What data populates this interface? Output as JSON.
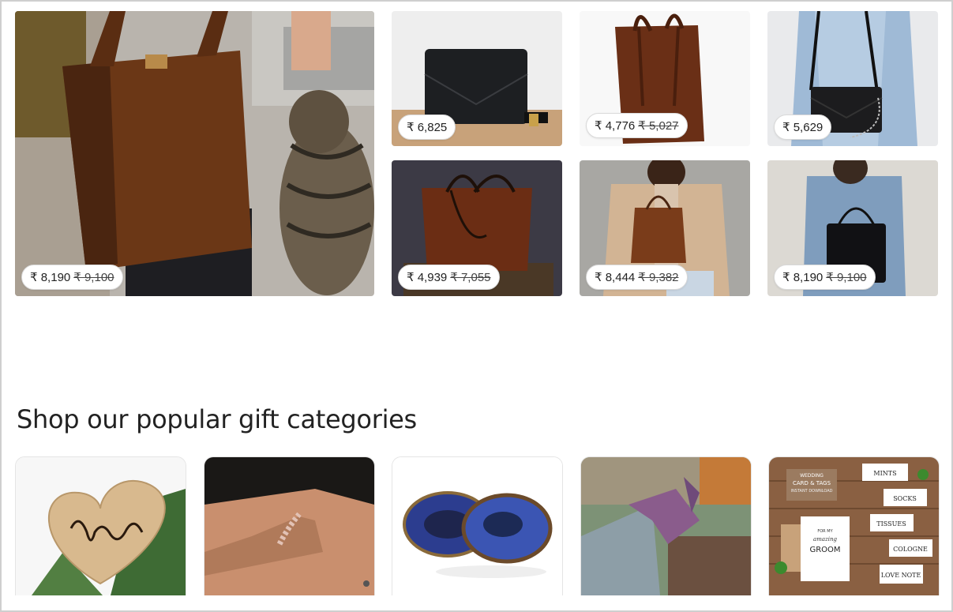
{
  "listings": [
    {
      "price": "₹ 8,190",
      "original_price": "₹ 9,100",
      "image": "brown-leather-tote-with-cat"
    },
    {
      "price": "₹ 6,825",
      "original_price": "",
      "image": "black-crossbody-bag"
    },
    {
      "price": "₹ 4,776",
      "original_price": "₹ 5,027",
      "image": "brown-leather-tote"
    },
    {
      "price": "₹ 5,629",
      "original_price": "",
      "image": "black-shoulder-bag-chain"
    },
    {
      "price": "₹ 4,939",
      "original_price": "₹ 7,055",
      "image": "cognac-leather-tote"
    },
    {
      "price": "₹ 8,444",
      "original_price": "₹ 9,382",
      "image": "brown-leather-backpack"
    },
    {
      "price": "₹ 8,190",
      "original_price": "₹ 9,100",
      "image": "black-leather-bucket-bag"
    }
  ],
  "section": {
    "title": "Shop our popular gift categories"
  },
  "categories": [
    {
      "image": "love-you-wooden-heart-topper"
    },
    {
      "image": "beaded-bracelet-on-wrist"
    },
    {
      "image": "beaded-brooches"
    },
    {
      "image": "fabric-hummingbird"
    },
    {
      "image": "wedding-card-and-tags",
      "card_title": "WEDDING",
      "card_sub": "CARD & TAGS",
      "card_note": "INSTANT DOWNLOAD",
      "tags": [
        "MINTS",
        "SOCKS",
        "TISSUES",
        "COLOGNE",
        "LOVE NOTE"
      ],
      "groom_line1": "FOR MY",
      "groom_line2": "amazing",
      "groom_line3": "GROOM"
    }
  ],
  "colors": {
    "pill_bg": "#ffffff",
    "heading": "#222222",
    "frame_border": "#cfcfcf"
  }
}
